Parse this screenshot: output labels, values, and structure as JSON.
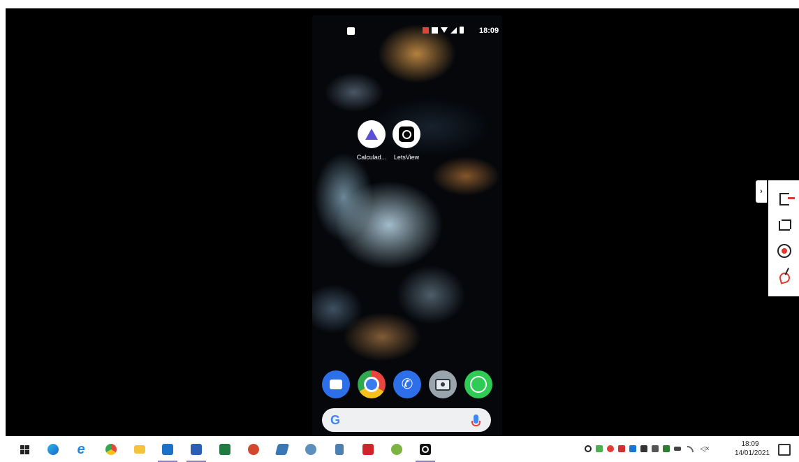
{
  "phone": {
    "status_time": "18:09",
    "apps": [
      {
        "label": "Calculad...",
        "icon": "calculator-pyramid-icon"
      },
      {
        "label": "LetsView",
        "icon": "letsview-icon"
      }
    ],
    "dock": [
      "messages-icon",
      "chrome-icon",
      "phone-icon",
      "camera-icon",
      "whatsapp-icon"
    ],
    "search": {
      "logo": "G",
      "mic_icon": "mic-icon"
    }
  },
  "side_toolbar": {
    "expand_label": "›",
    "tools": [
      "exit-icon",
      "crop-icon",
      "record-icon",
      "draw-icon"
    ]
  },
  "taskbar": {
    "clock_time": "18:09",
    "clock_date": "14/01/2021",
    "volume_icon": "◁×",
    "apps": [
      "windows-start-icon",
      "edge-icon",
      "ie-icon",
      "chrome-icon",
      "file-explorer-icon",
      "outlook-icon",
      "word-icon",
      "excel-icon",
      "powerpoint-icon",
      "notepad-icon",
      "paint-icon",
      "calculator-icon",
      "acrobat-icon",
      "android-app-icon",
      "letsview-icon"
    ]
  },
  "colors": {
    "accent": "#e03a2f",
    "taskbar_underline": "#8e7cc3"
  }
}
